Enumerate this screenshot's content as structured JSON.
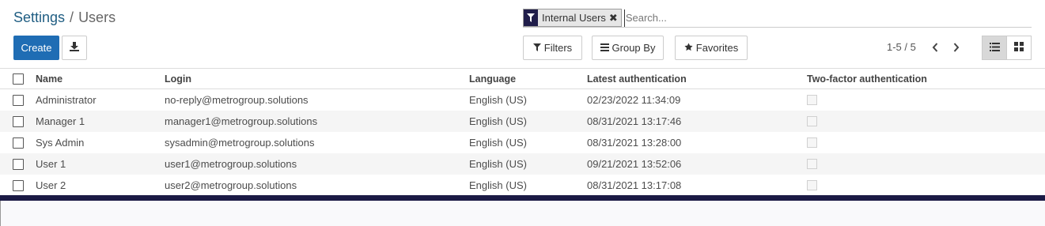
{
  "breadcrumb": {
    "parent": "Settings",
    "separator": "/",
    "current": "Users"
  },
  "toolbar": {
    "create_label": "Create",
    "download_icon": "download-icon"
  },
  "search": {
    "facet_icon": "filter-icon",
    "facet_label": "Internal Users",
    "facet_remove": "✖",
    "placeholder": "Search..."
  },
  "filters": {
    "filters_label": "Filters",
    "groupby_label": "Group By",
    "favorites_label": "Favorites"
  },
  "pager": {
    "value": "1-5 / 5"
  },
  "table": {
    "columns": [
      "Name",
      "Login",
      "Language",
      "Latest authentication",
      "Two-factor authentication"
    ],
    "rows": [
      {
        "name": "Administrator",
        "login": "no-reply@metrogroup.solutions",
        "language": "English (US)",
        "auth": "02/23/2022 11:34:09"
      },
      {
        "name": "Manager 1",
        "login": "manager1@metrogroup.solutions",
        "language": "English (US)",
        "auth": "08/31/2021 13:17:46"
      },
      {
        "name": "Sys Admin",
        "login": "sysadmin@metrogroup.solutions",
        "language": "English (US)",
        "auth": "08/31/2021 13:28:00"
      },
      {
        "name": "User 1",
        "login": "user1@metrogroup.solutions",
        "language": "English (US)",
        "auth": "09/21/2021 13:52:06"
      },
      {
        "name": "User 2",
        "login": "user2@metrogroup.solutions",
        "language": "English (US)",
        "auth": "08/31/2021 13:17:08"
      }
    ]
  },
  "colors": {
    "primary": "#1f6db4",
    "brand_dark": "#1b1a45",
    "link": "#1f5d82"
  }
}
